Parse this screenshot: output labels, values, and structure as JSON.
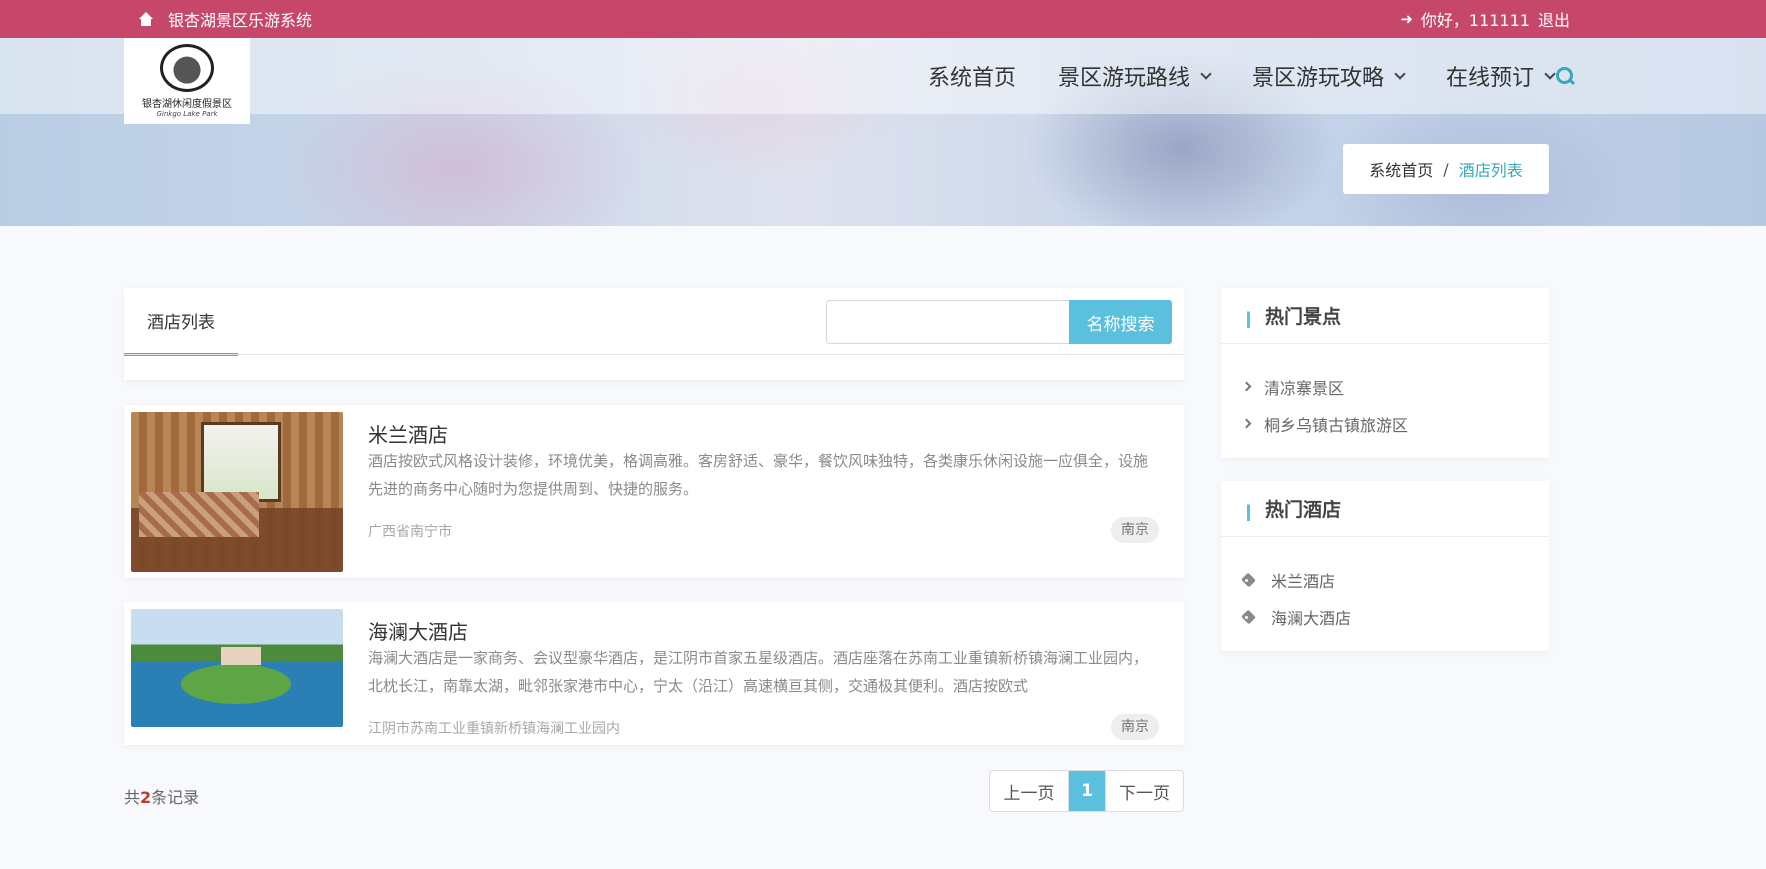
{
  "topbar": {
    "site_name": "银杏湖景区乐游系统",
    "greeting": "你好，111111",
    "logout": "退出"
  },
  "logo": {
    "name": "银杏湖休闲度假景区",
    "subtitle": "Ginkgo Lake Park"
  },
  "nav": {
    "home": "系统首页",
    "routes": "景区游玩路线",
    "guides": "景区游玩攻略",
    "booking": "在线预订"
  },
  "breadcrumb": {
    "home": "系统首页",
    "separator": "/",
    "current": "酒店列表"
  },
  "main": {
    "tab": "酒店列表",
    "search_value": "",
    "search_button": "名称搜索",
    "hotels": [
      {
        "name": "米兰酒店",
        "desc": "酒店按欧式风格设计装修，环境优美，格调高雅。客房舒适、豪华，餐饮风味独特，各类康乐休闲设施一应俱全，设施先进的商务中心随时为您提供周到、快捷的服务。",
        "address": "广西省南宁市",
        "city": "南京"
      },
      {
        "name": "海澜大酒店",
        "desc": "海澜大酒店是一家商务、会议型豪华酒店，是江阴市首家五星级酒店。酒店座落在苏南工业重镇新桥镇海澜工业园内，北枕长江，南靠太湖，毗邻张家港市中心，宁太（沿江）高速横亘其侧，交通极其便利。酒店按欧式",
        "address": "江阴市苏南工业重镇新桥镇海澜工业园内",
        "city": "南京"
      }
    ],
    "record_prefix": "共",
    "record_count": "2",
    "record_suffix": "条记录",
    "pager": {
      "prev": "上一页",
      "current": "1",
      "next": "下一页"
    }
  },
  "sidebar": {
    "hot_spots_title": "热门景点",
    "hot_spots": [
      "清凉寨景区",
      "桐乡乌镇古镇旅游区"
    ],
    "hot_hotels_title": "热门酒店",
    "hot_hotels": [
      "米兰酒店",
      "海澜大酒店"
    ]
  },
  "colors": {
    "topbar": "#c7476b",
    "accent": "#5bc0de",
    "tab_underline": "#2ec5a8",
    "record_count": "#c0392b"
  }
}
